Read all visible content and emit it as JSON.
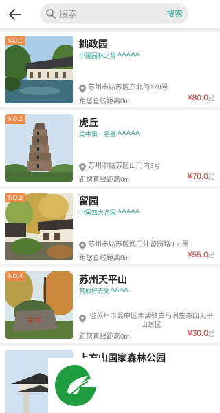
{
  "search": {
    "placeholder": "搜索",
    "button_label": "搜索"
  },
  "attractions": [
    {
      "rank": "NO.1",
      "name": "拙政园",
      "tagline": "中国园林之母",
      "grade": "AAAAA",
      "address": "苏州市姑苏区东北街178号",
      "distance": "距您直线距离0m",
      "price": "¥80.0",
      "price_unit": "起"
    },
    {
      "rank": "NO.2",
      "name": "虎丘",
      "tagline": "吴中第一名胜",
      "grade": "AAAAA",
      "address": "苏州市姑苏区山门内8号",
      "distance": "距您直线距离0m",
      "price": "¥70.0",
      "price_unit": "起"
    },
    {
      "rank": "NO.3",
      "name": "留园",
      "tagline": "中国四大名园",
      "grade": "AAAAA",
      "address": "苏州市姑苏区阊门外留园路338号",
      "distance": "距您直线距离0m",
      "price": "¥55.0",
      "price_unit": "起"
    },
    {
      "rank": "NO.4",
      "name": "苏州天平山",
      "tagline": "赏枫好去处",
      "grade": "AAAA",
      "address": "省苏州市吴中区木渎镇白马涧生态园天平山景区",
      "distance": "距您直线距离0m",
      "price": "¥30.0",
      "price_unit": "起"
    },
    {
      "name": "上方山国家森林公园"
    }
  ],
  "colors": {
    "accent": "#2f9f8c",
    "rank_badge": "#f08a4b",
    "price": "#e0312f",
    "logo_green": "#1e9e3e"
  },
  "icons": {
    "back": "arrow-left-icon",
    "search": "search-icon",
    "location": "location-pin-icon",
    "logo": "leaf-logo-icon"
  }
}
